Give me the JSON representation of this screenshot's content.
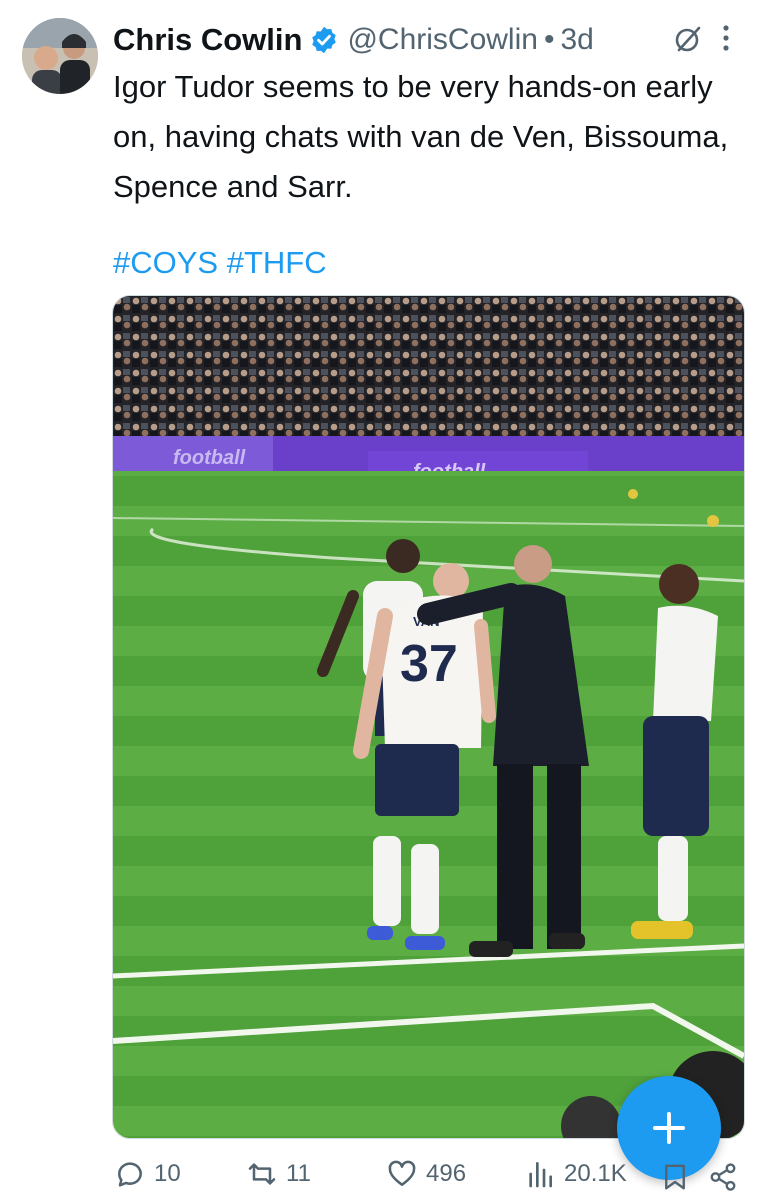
{
  "tweet": {
    "author": {
      "display_name": "Chris Cowlin",
      "handle": "@ChrisCowlin",
      "verified": true
    },
    "separator": "•",
    "time": "3d",
    "text": "Igor Tudor seems to be very hands-on early on, having chats with van de Ven, Bissouma, Spence and Sarr.",
    "hashtags": [
      "#COYS",
      "#THFC"
    ],
    "media": {
      "kind": "photo",
      "board_text_left": "football",
      "board_text_mid": "football",
      "shirt_number": "37",
      "shirt_name": "VAN"
    }
  },
  "actions": {
    "replies": "10",
    "reposts": "11",
    "likes": "496",
    "views": "20.1K"
  },
  "icons": {
    "verified": "verified-badge-icon",
    "grok": "grok-icon",
    "more": "more-options-icon",
    "reply": "reply-icon",
    "repost": "repost-icon",
    "like": "heart-icon",
    "views": "views-bar-icon",
    "bookmark": "bookmark-icon",
    "share": "share-icon",
    "compose": "plus-icon"
  },
  "colors": {
    "accent": "#1d9bf0",
    "secondary_text": "#536471",
    "primary_text": "#0f1419"
  }
}
